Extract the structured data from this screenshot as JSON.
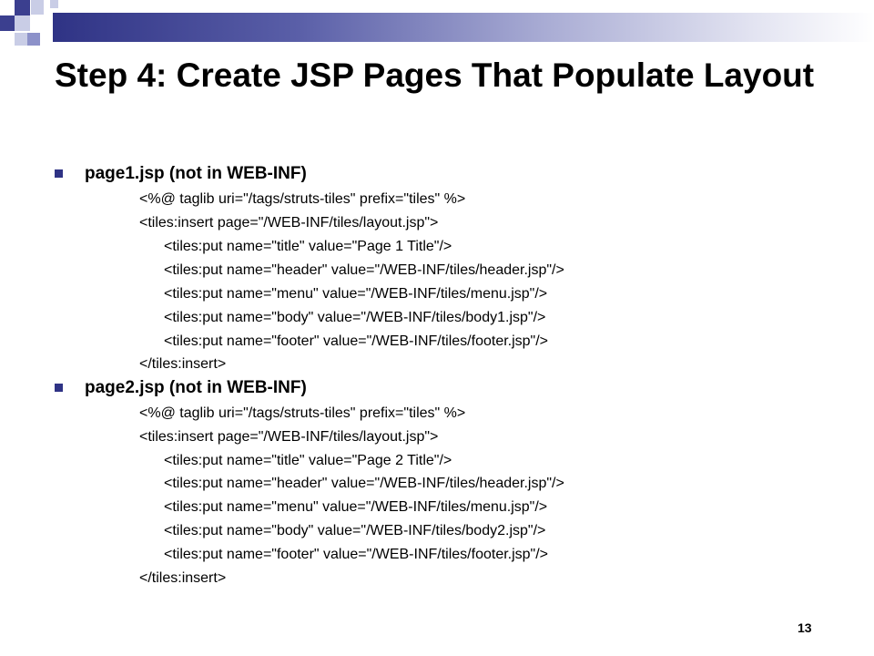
{
  "slide": {
    "title": "Step 4: Create JSP Pages That Populate Layout",
    "page_number": "13",
    "colors": {
      "accent_dark": "#2f3385",
      "accent_light": "#c9cde6"
    }
  },
  "sections": [
    {
      "heading": "page1.jsp (not in WEB-INF)",
      "code": [
        "<%@ taglib uri=\"/tags/struts-tiles\" prefix=\"tiles\" %>",
        "<tiles:insert page=\"/WEB-INF/tiles/layout.jsp\">",
        "<tiles:put name=\"title\" value=\"Page 1 Title\"/>",
        "<tiles:put name=\"header\" value=\"/WEB-INF/tiles/header.jsp\"/>",
        "<tiles:put name=\"menu\" value=\"/WEB-INF/tiles/menu.jsp\"/>",
        "<tiles:put name=\"body\" value=\"/WEB-INF/tiles/body1.jsp\"/>",
        "<tiles:put name=\"footer\" value=\"/WEB-INF/tiles/footer.jsp\"/>",
        "</tiles:insert>"
      ]
    },
    {
      "heading": "page2.jsp (not in WEB-INF)",
      "code": [
        "<%@ taglib uri=\"/tags/struts-tiles\" prefix=\"tiles\" %>",
        "<tiles:insert page=\"/WEB-INF/tiles/layout.jsp\">",
        "<tiles:put name=\"title\" value=\"Page 2 Title\"/>",
        "<tiles:put name=\"header\" value=\"/WEB-INF/tiles/header.jsp\"/>",
        "<tiles:put name=\"menu\" value=\"/WEB-INF/tiles/menu.jsp\"/>",
        "<tiles:put name=\"body\" value=\"/WEB-INF/tiles/body2.jsp\"/>",
        "<tiles:put name=\"footer\" value=\"/WEB-INF/tiles/footer.jsp\"/>",
        "</tiles:insert>"
      ]
    }
  ]
}
